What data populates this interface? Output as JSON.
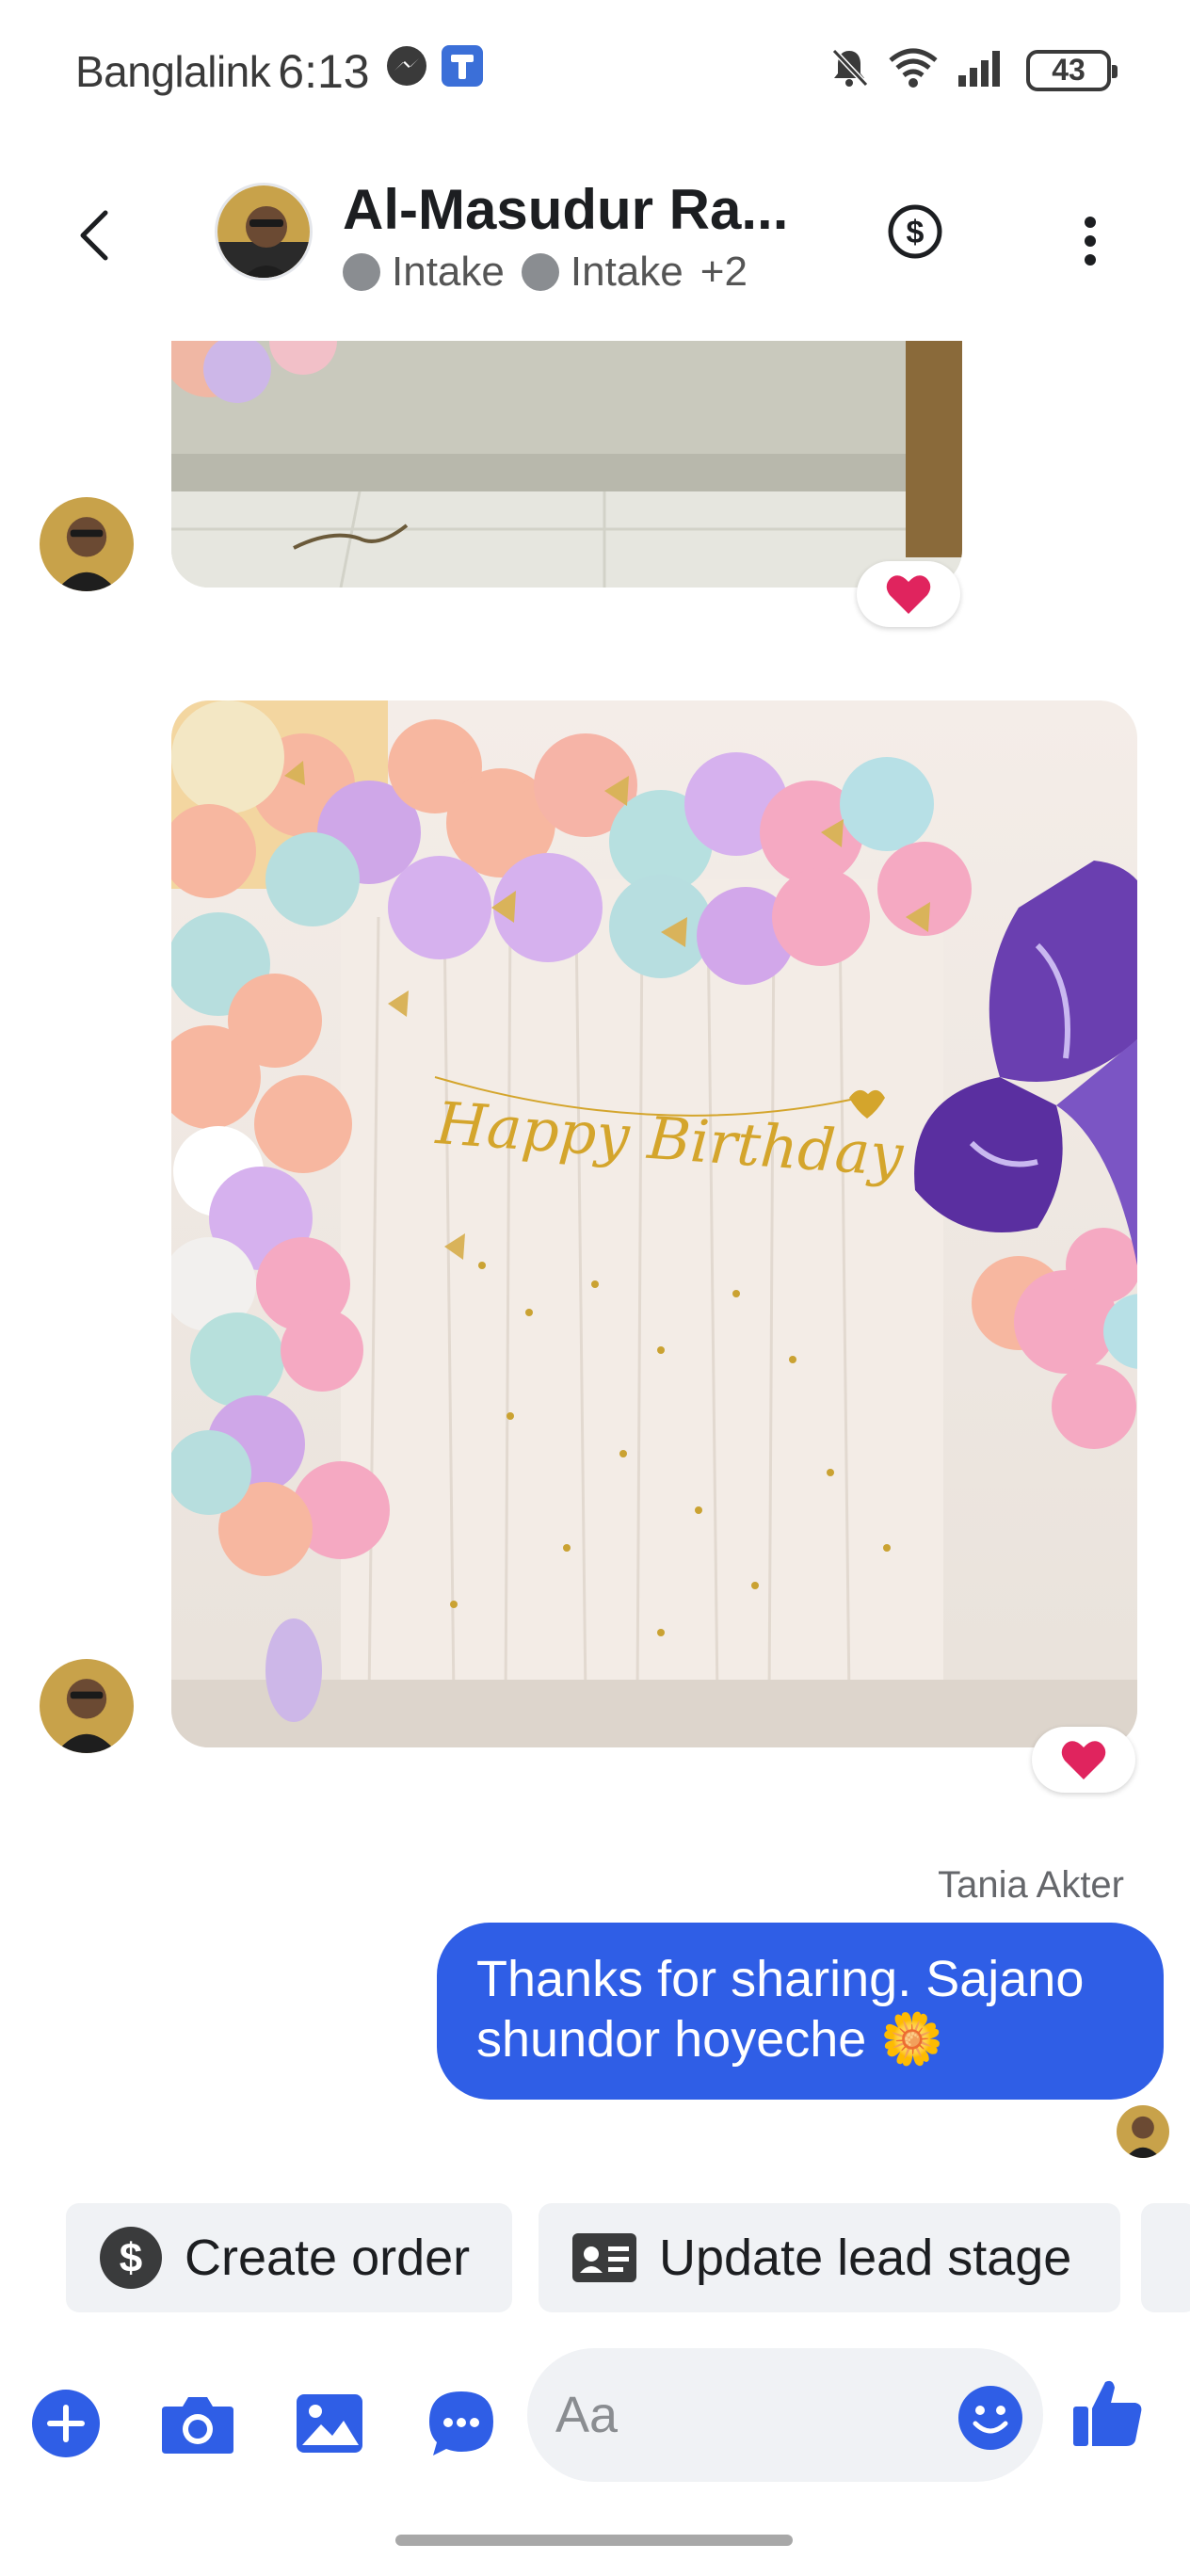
{
  "status_bar": {
    "carrier": "Banglalink",
    "time": "6:13",
    "battery": "43"
  },
  "header": {
    "contact_name": "Al-Masudur Ra...",
    "tags": [
      "Intake",
      "Intake"
    ],
    "tags_more": "+2"
  },
  "messages": [
    {
      "type": "image",
      "direction": "incoming",
      "content": "photo (cropped top)",
      "reaction": "heart"
    },
    {
      "type": "image",
      "direction": "incoming",
      "content": "birthday balloon decoration photo",
      "reaction": "heart",
      "banner_text": "Happy Birthday"
    },
    {
      "type": "text",
      "direction": "outgoing",
      "sender": "Tania Akter",
      "line1": "Thanks for sharing. Sajano",
      "line2": "shundor hoyeche",
      "emoji": "🌼"
    }
  ],
  "quick_actions": [
    {
      "label": "Create order",
      "icon": "dollar-icon"
    },
    {
      "label": "Update lead stage",
      "icon": "contact-card-icon"
    }
  ],
  "composer": {
    "placeholder": "Aa"
  },
  "colors": {
    "accent": "#2f5ee6",
    "reaction_heart": "#e0245e",
    "chip_bg": "#f0f2f5"
  }
}
